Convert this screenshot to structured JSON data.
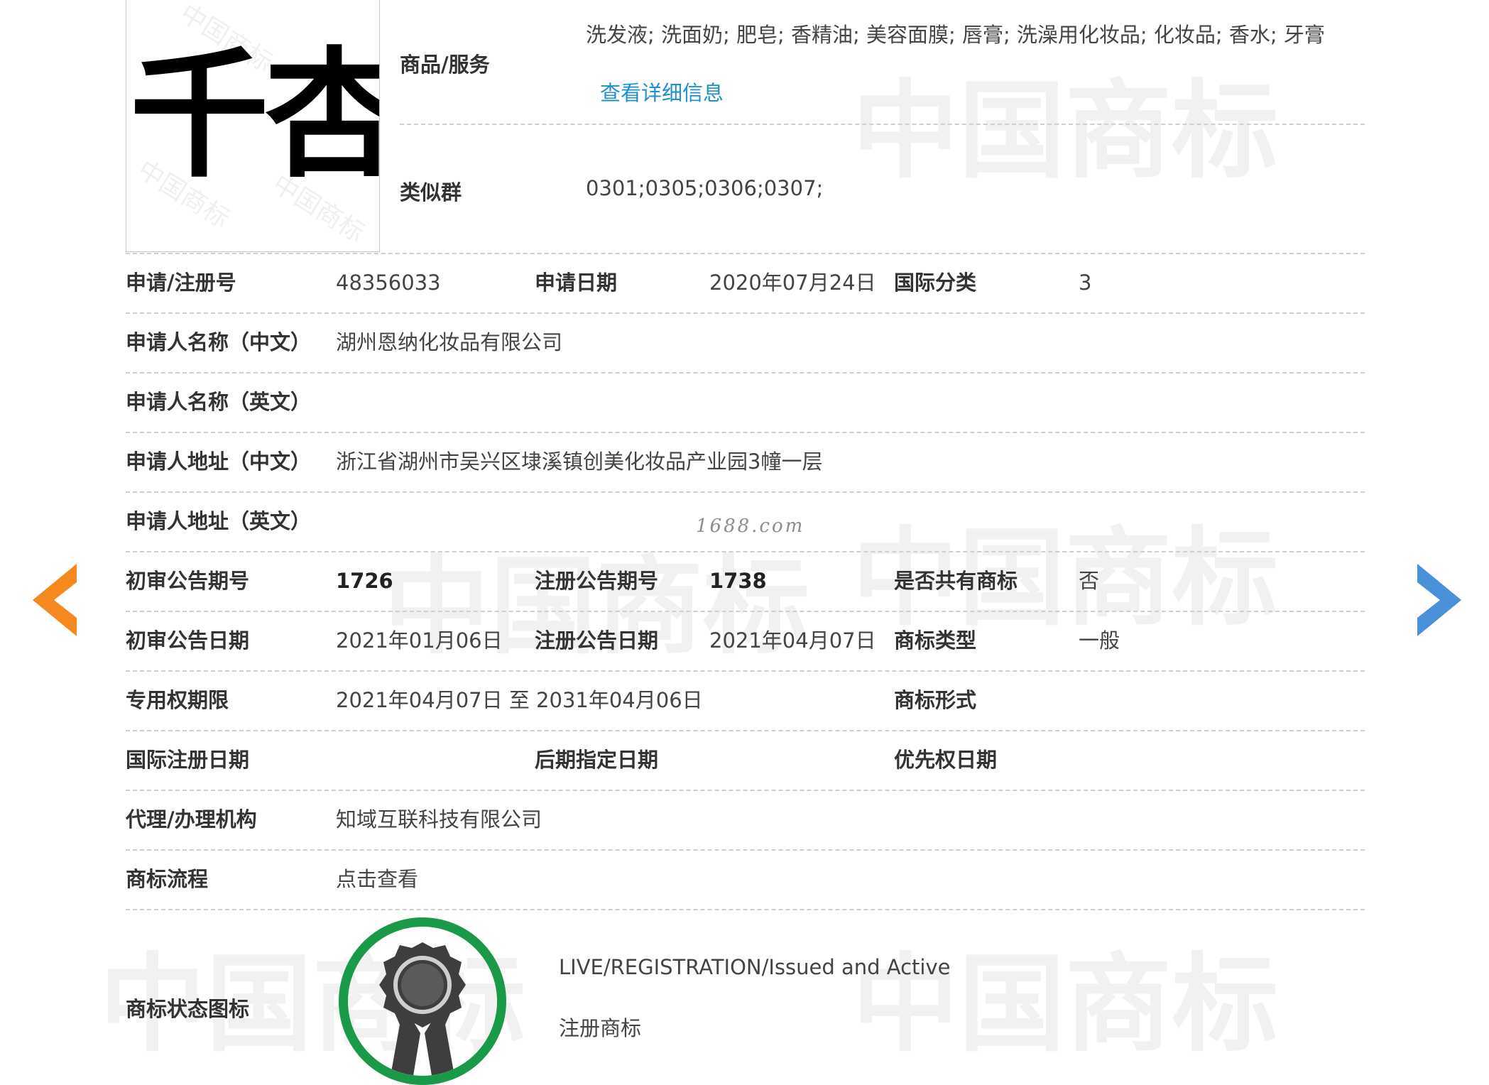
{
  "trademark": {
    "logo_text": "千杏",
    "seal_text": "中国商标"
  },
  "watermark": {
    "bg_text": "中国商标",
    "site": "1688.com"
  },
  "goods_services": {
    "label": "商品/服务",
    "value": "洗发液; 洗面奶; 肥皂; 香精油; 美容面膜; 唇膏; 洗澡用化妆品; 化妆品; 香水; 牙膏",
    "detail_link": "查看详细信息"
  },
  "similar_group": {
    "label": "类似群",
    "value": "0301;0305;0306;0307;"
  },
  "fields": {
    "reg_no": {
      "label": "申请/注册号",
      "value": "48356033"
    },
    "app_date": {
      "label": "申请日期",
      "value": "2020年07月24日"
    },
    "intl_class": {
      "label": "国际分类",
      "value": "3"
    },
    "applicant_cn": {
      "label": "申请人名称（中文）",
      "value": "湖州恩纳化妆品有限公司"
    },
    "applicant_en": {
      "label": "申请人名称（英文）",
      "value": ""
    },
    "address_cn": {
      "label": "申请人地址（中文）",
      "value": "浙江省湖州市吴兴区埭溪镇创美化妆品产业园3幢一层"
    },
    "address_en": {
      "label": "申请人地址（英文）",
      "value": ""
    },
    "prelim_issue_no": {
      "label": "初审公告期号",
      "value": "1726"
    },
    "reg_issue_no": {
      "label": "注册公告期号",
      "value": "1738"
    },
    "shared_mark": {
      "label": "是否共有商标",
      "value": "否"
    },
    "prelim_date": {
      "label": "初审公告日期",
      "value": "2021年01月06日"
    },
    "reg_date": {
      "label": "注册公告日期",
      "value": "2021年04月07日"
    },
    "mark_type": {
      "label": "商标类型",
      "value": "一般"
    },
    "exclusive_period": {
      "label": "专用权期限",
      "value": "2021年04月07日 至 2031年04月06日"
    },
    "mark_form": {
      "label": "商标形式",
      "value": ""
    },
    "intl_reg_date": {
      "label": "国际注册日期",
      "value": ""
    },
    "later_designation": {
      "label": "后期指定日期",
      "value": ""
    },
    "priority_date": {
      "label": "优先权日期",
      "value": ""
    },
    "agency": {
      "label": "代理/办理机构",
      "value": "知域互联科技有限公司"
    },
    "process": {
      "label": "商标流程",
      "value": "点击查看"
    }
  },
  "status": {
    "label": "商标状态图标",
    "status_en": "LIVE/REGISTRATION/Issued and Active",
    "status_cn": "注册商标"
  },
  "colors": {
    "link": "#1e8fd0",
    "prev_arrow": "#f5891f",
    "next_arrow": "#4a90d9",
    "status_ring": "#1a9a48",
    "badge": "#3e3e3e"
  },
  "icons": {
    "prev": "chevron-left-icon",
    "next": "chevron-right-icon",
    "status": "award-badge-icon"
  }
}
